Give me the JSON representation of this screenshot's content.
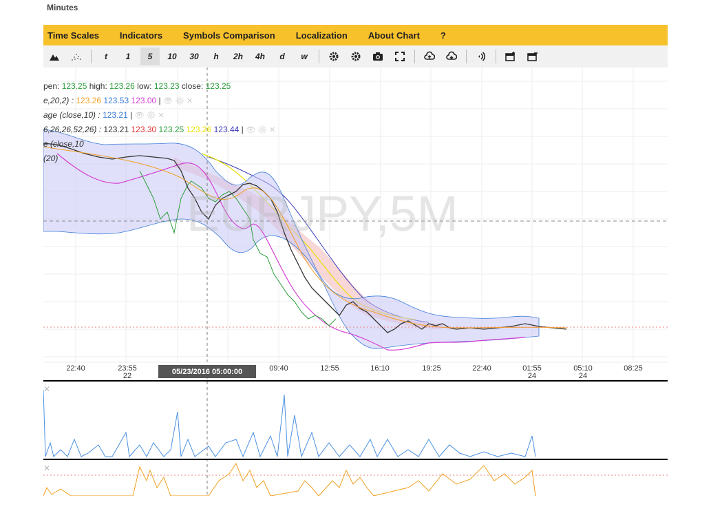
{
  "page_title": "Minutes",
  "menu": [
    {
      "label": "Time Scales"
    },
    {
      "label": "Indicators"
    },
    {
      "label": "Symbols Comparison"
    },
    {
      "label": "Localization"
    },
    {
      "label": "About Chart"
    },
    {
      "label": "?"
    }
  ],
  "toolbar": {
    "timeframes": [
      "t",
      "1",
      "5",
      "10",
      "30",
      "h",
      "2h",
      "4h",
      "d",
      "w"
    ],
    "active_timeframe": "5"
  },
  "legend": {
    "ohlc": {
      "open_label": "open:",
      "open": "123.25",
      "high_label": "high:",
      "high": "123.26",
      "low_label": "low:",
      "low": "123.23",
      "close_label": "close:",
      "close": "123.25",
      "prefix": "pen:"
    },
    "bands": {
      "name": "e,20,2) :",
      "v1": "123.26",
      "v2": "123.53",
      "v3": "123.00"
    },
    "sma": {
      "name": "age (close,10) :",
      "v1": "123.21"
    },
    "ichimoku": {
      "name": "6,26,26,52,26) :",
      "v1": "123.21",
      "v2": "123.30",
      "v3": "123.25",
      "v4": "123.26",
      "v5": "123.44"
    },
    "ema": {
      "name": "e (close,10"
    },
    "other": {
      "name": "(20)"
    }
  },
  "watermark": "EURJPY,5M",
  "xaxis": {
    "ticks": [
      {
        "label": "22:40",
        "sub": ""
      },
      {
        "label": "23:55",
        "sub": "22"
      },
      {
        "label": "09:40",
        "sub": ""
      },
      {
        "label": "12:55",
        "sub": ""
      },
      {
        "label": "16:10",
        "sub": ""
      },
      {
        "label": "19:25",
        "sub": ""
      },
      {
        "label": "22:40",
        "sub": ""
      },
      {
        "label": "01:55",
        "sub": "24"
      },
      {
        "label": "05:10",
        "sub": "24"
      },
      {
        "label": "08:25",
        "sub": ""
      }
    ],
    "crosshair_label": "05/23/2016 05:00:00"
  },
  "colors": {
    "menu_bg": "#f7c12b",
    "toolbar_bg": "#f1f1f1",
    "volume": "#4a90e2",
    "oscillator": "#f0a020",
    "bands_fill": "#c9c6f5",
    "cloud_fill": "#f5c6c6"
  }
}
